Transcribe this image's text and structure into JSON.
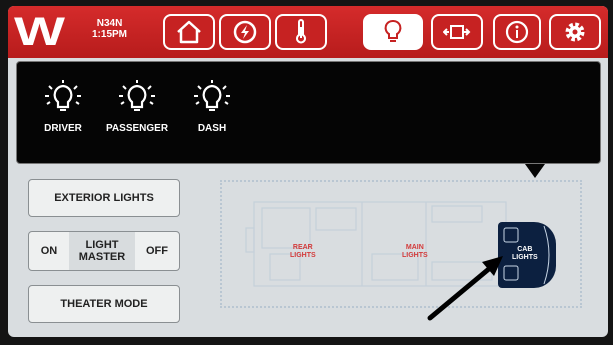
{
  "header": {
    "logo": "W",
    "location": "N34N",
    "time": "1:15PM"
  },
  "tabs": [
    {
      "icon": "home-icon",
      "active": false
    },
    {
      "icon": "generator-icon",
      "active": false
    },
    {
      "icon": "thermometer-icon",
      "active": false
    },
    {
      "icon": "lightbulb-icon",
      "active": true
    },
    {
      "icon": "slide-out-icon",
      "active": false
    },
    {
      "icon": "info-icon",
      "active": false
    },
    {
      "icon": "gear-icon",
      "active": false
    }
  ],
  "lights": [
    {
      "label": "DRIVER"
    },
    {
      "label": "PASSENGER"
    },
    {
      "label": "DASH"
    }
  ],
  "controls": {
    "exterior": "EXTERIOR LIGHTS",
    "on": "ON",
    "master_line1": "LIGHT",
    "master_line2": "MASTER",
    "off": "OFF",
    "theater": "THEATER MODE"
  },
  "floorplan": {
    "rear_1": "REAR",
    "rear_2": "LIGHTS",
    "main_1": "MAIN",
    "main_2": "LIGHTS",
    "cab_1": "CAB",
    "cab_2": "LIGHTS"
  },
  "colors": {
    "brand_red": "#c62222",
    "zone_red": "#d33a3a",
    "cab_blue": "#0c2040"
  }
}
